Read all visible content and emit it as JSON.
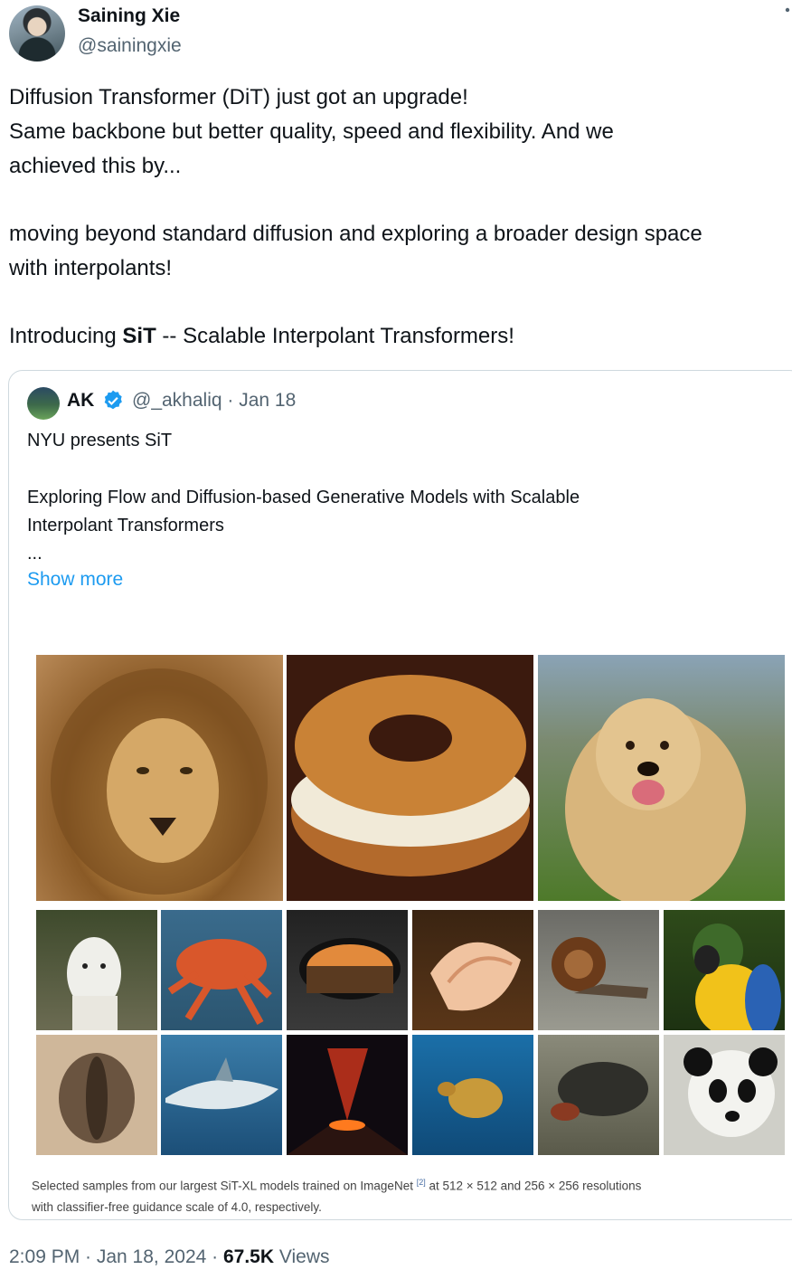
{
  "tweet": {
    "author_name": "Saining Xie",
    "author_handle": "@sainingxie",
    "more_icon": "more-vertical-icon",
    "text_lines": [
      "Diffusion Transformer (DiT) just got an upgrade!",
      "Same backbone but better quality, speed and flexibility. And we",
      "achieved this by...",
      "moving beyond standard diffusion and exploring a broader design space",
      "with interpolants!"
    ],
    "intro_prefix": "Introducing ",
    "intro_bold": "SiT",
    "intro_suffix": " -- Scalable Interpolant Transformers!",
    "timestamp": "2:09 PM · Jan 18, 2024 · ",
    "views_count": "67.5K",
    "views_label": " Views"
  },
  "quote": {
    "author_name": "AK",
    "verified_icon": "verified-badge-icon",
    "verified_color": "#1d9bf0",
    "handle_date": "@_akhaliq · Jan 18",
    "line1": "NYU presents SiT",
    "line2": "Exploring Flow and Diffusion-based Generative Models with Scalable",
    "line3": "Interpolant Transformers",
    "ellipsis": "...",
    "show_more": "Show more",
    "caption_part1": "Selected samples from our largest SiT-XL models trained on ImageNet ",
    "caption_ref": "[2]",
    "caption_part2": " at 512 × 512 and 256 × 256 resolutions",
    "caption_line2": "with classifier-free guidance scale of 4.0, respectively."
  },
  "colors": {
    "text": "#0f1419",
    "secondary": "#536471",
    "link": "#1d9bf0",
    "border": "#cfd9de"
  }
}
